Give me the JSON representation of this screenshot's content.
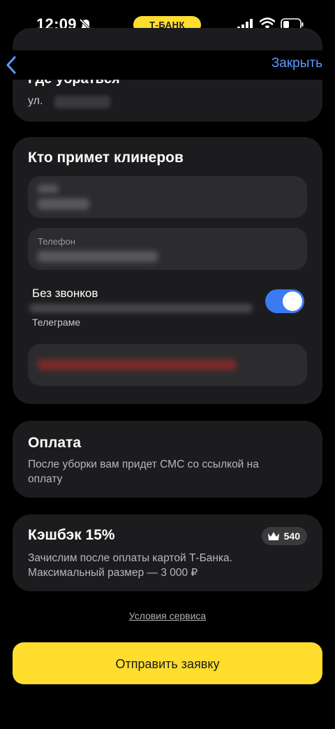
{
  "status_bar": {
    "time": "12:09",
    "bank_label": "Т-БАНК",
    "icons": [
      "bell-muted-icon",
      "signal-icon",
      "wifi-icon",
      "battery-icon"
    ]
  },
  "nav": {
    "back_icon": "chevron-left-icon",
    "close_label": "Закрыть"
  },
  "address_card": {
    "title": "Где убраться",
    "street_prefix": "ул."
  },
  "receiver_card": {
    "title": "Кто примет клинеров",
    "phone_label": "Телефон",
    "no_calls_label": "Без звонков",
    "no_calls_sub": "Телеграме",
    "no_calls_enabled": true
  },
  "payment_card": {
    "title": "Оплата",
    "text": "После уборки вам придет СМС со ссылкой на оплату"
  },
  "cashback_card": {
    "title": "Кэшбэк 15%",
    "text": "Зачислим после оплаты картой Т-Банка. Максимальный размер — 3 000 ₽",
    "points": "540",
    "points_icon": "crown-icon"
  },
  "terms_label": "Условия сервиса",
  "submit_label": "Отправить заявку",
  "colors": {
    "background": "#000000",
    "card": "#1c1c1e",
    "field": "#2c2c2e",
    "accent_yellow": "#ffdd2d",
    "link_blue": "#5c9bff",
    "toggle_blue": "#3a7bf0"
  }
}
